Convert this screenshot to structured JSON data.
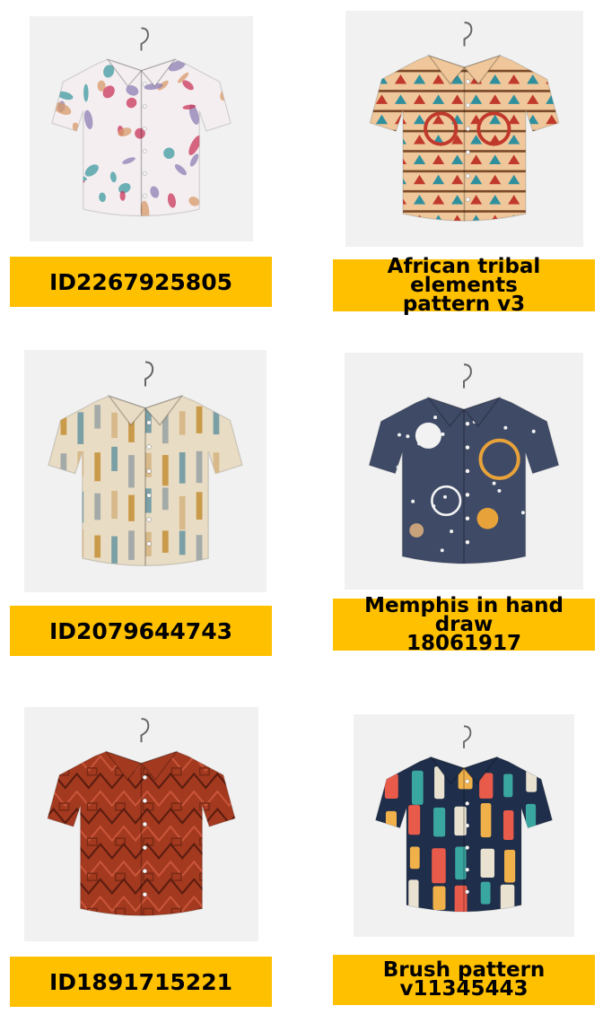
{
  "products": [
    {
      "image": "white shirt with colorful feather print",
      "line1": "ID2267925805",
      "line2": "",
      "colors": {
        "base": "#f4eef0",
        "accent1": "#c9365a",
        "accent2": "#8e7fb6",
        "accent3": "#3f9aa0",
        "accent4": "#d89a6a"
      }
    },
    {
      "image": "beige shirt with African tribal elements pattern",
      "line1": "African tribal elements",
      "line2": "pattern v3",
      "colors": {
        "base": "#efc79a",
        "accent1": "#c0392b",
        "accent2": "#2f8f9d",
        "accent3": "#7a4a2a",
        "accent4": "#e8a24a"
      }
    },
    {
      "image": "cream shirt with vertical bar pattern",
      "line1": "ID2079644743",
      "line2": "",
      "colors": {
        "base": "#e9dcc4",
        "accent1": "#c99a4a",
        "accent2": "#7aa0a6",
        "accent3": "#a4aaa8",
        "accent4": "#d7b98a"
      }
    },
    {
      "image": "navy shirt with Memphis hand drawn shapes",
      "line1": "Memphis in hand draw",
      "line2": "18061917",
      "colors": {
        "base": "#3e4a66",
        "accent1": "#e8a23a",
        "accent2": "#48a9a6",
        "accent3": "#f2f2f2",
        "accent4": "#c7a27a"
      }
    },
    {
      "image": "rust red shirt with geometric zigzag pattern",
      "line1": "ID1891715221",
      "line2": "",
      "colors": {
        "base": "#a3391f",
        "accent1": "#5a1d10",
        "accent2": "#c8553a",
        "accent3": "#7a2a15",
        "accent4": "#d06a48"
      }
    },
    {
      "image": "navy shirt with colorful brush strokes",
      "line1": "Brush pattern",
      "line2": "v11345443",
      "colors": {
        "base": "#1f2e4a",
        "accent1": "#e85a4a",
        "accent2": "#3aa6a0",
        "accent3": "#e9e2d0",
        "accent4": "#f0b04a"
      }
    }
  ]
}
